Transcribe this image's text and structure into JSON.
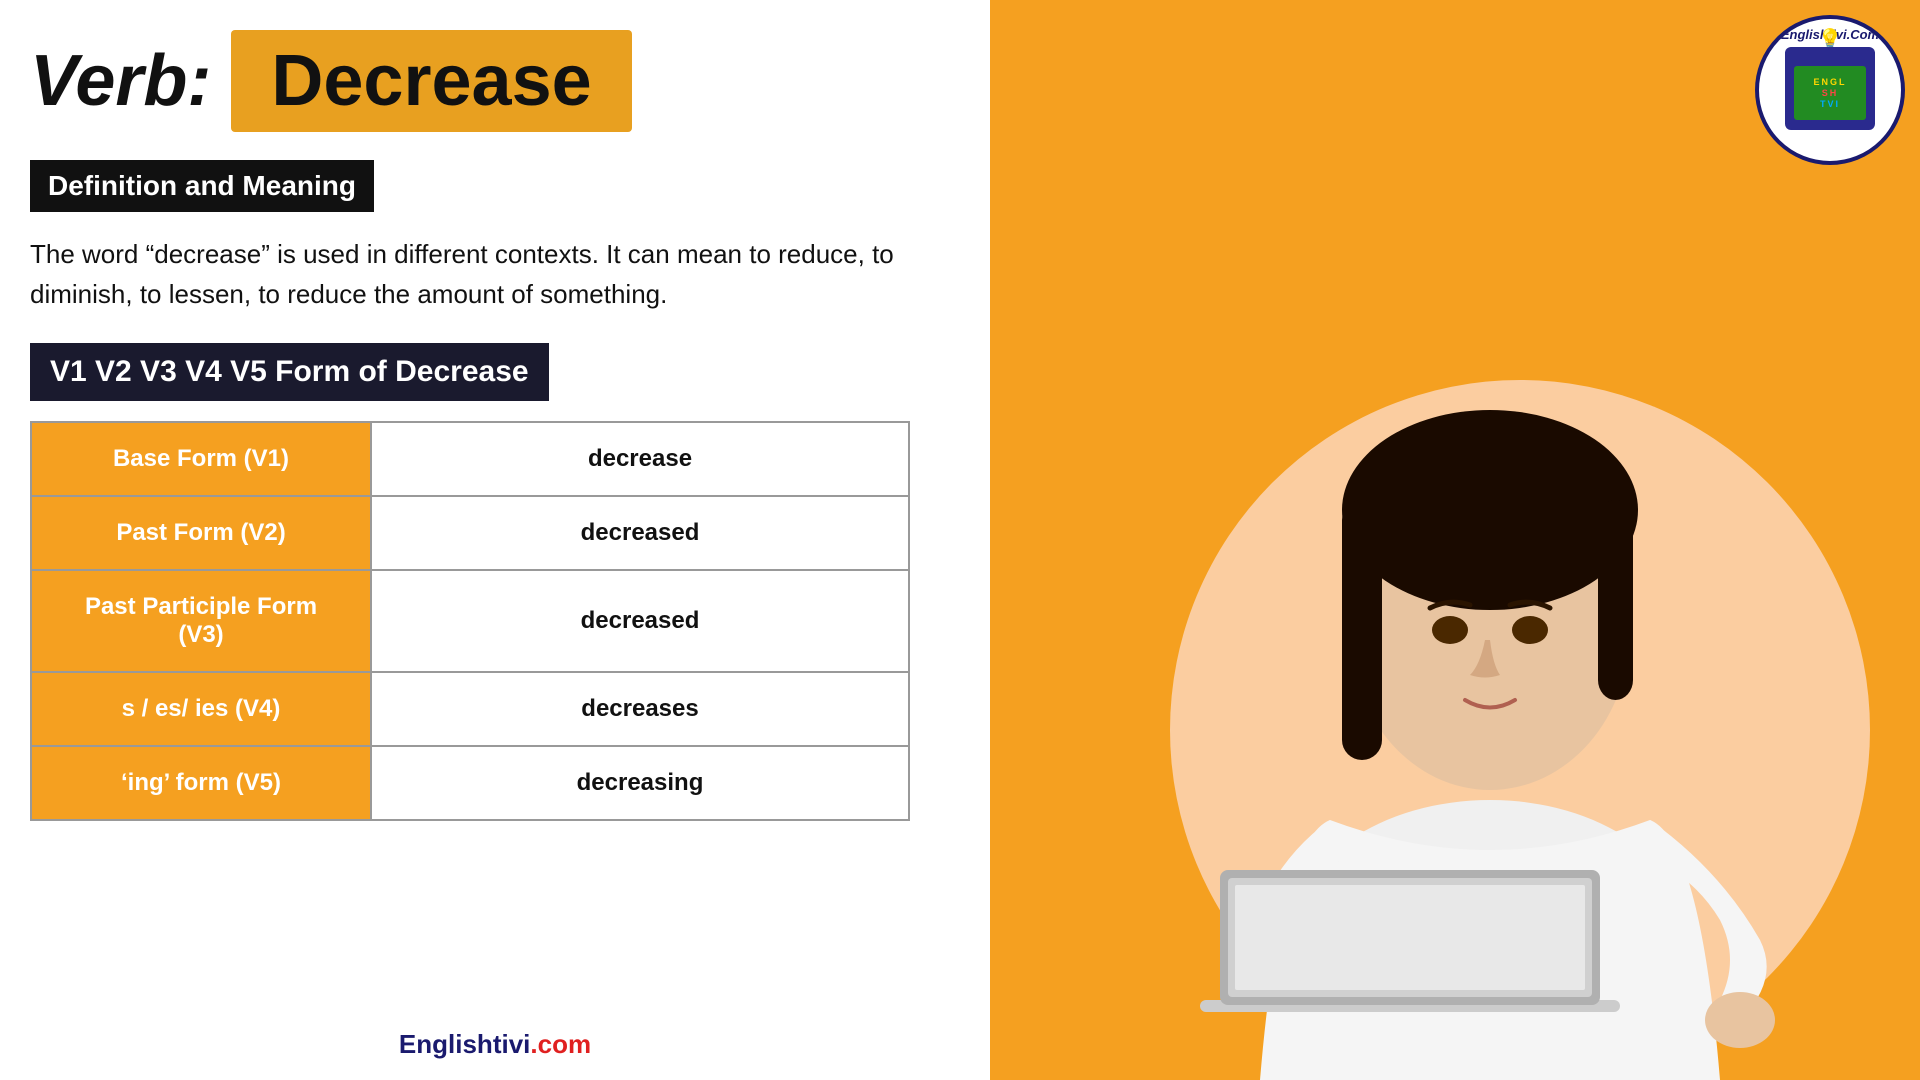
{
  "header": {
    "verb_label": "Verb:",
    "verb_word": "Decrease"
  },
  "definition_section": {
    "heading": "Definition and Meaning",
    "text": "The word “decrease” is used in different contexts. It can mean to reduce, to diminish, to lessen, to reduce the amount of something."
  },
  "forms_section": {
    "heading": "V1 V2 V3 V4 V5 Form of Decrease",
    "rows": [
      {
        "label": "Base Form (V1)",
        "value": "decrease"
      },
      {
        "label": "Past Form (V2)",
        "value": "decreased"
      },
      {
        "label": "Past Participle Form (V3)",
        "value": "decreased"
      },
      {
        "label": "s / es/ ies (V4)",
        "value": "decreases"
      },
      {
        "label": "‘ing’ form (V5)",
        "value": "decreasing"
      }
    ]
  },
  "footer": {
    "blue_text": "Englishtivi",
    "red_text": ".com"
  },
  "logo": {
    "top_text": "Englishtivi.Com",
    "tv_label": "ENGL\nSH\nTVI",
    "bottom_text": ""
  },
  "colors": {
    "orange": "#F5A020",
    "dark_navy": "#1a1a2e",
    "black": "#111111",
    "white": "#ffffff",
    "peach": "#FBCDA0"
  }
}
